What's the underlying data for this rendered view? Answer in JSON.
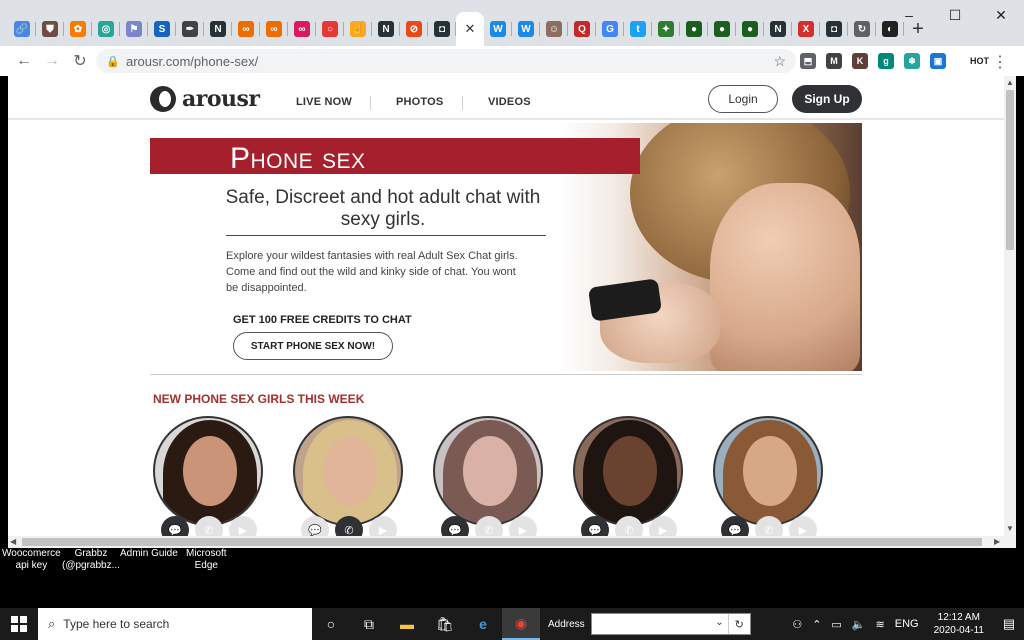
{
  "browser": {
    "tabs": [
      {
        "icon": "link-icon",
        "color": "#4a86e8",
        "glyph": "🔗"
      },
      {
        "icon": "shield-icon",
        "color": "#6d4c41",
        "glyph": "⛊"
      },
      {
        "icon": "orange-flower-icon",
        "color": "#f57c00",
        "glyph": "✿"
      },
      {
        "icon": "teal-swirl-icon",
        "color": "#26a69a",
        "glyph": "◎"
      },
      {
        "icon": "bug-icon",
        "color": "#7986cb",
        "glyph": "⚑"
      },
      {
        "icon": "s-logo-icon",
        "color": "#1565c0",
        "glyph": "S"
      },
      {
        "icon": "feather-icon",
        "color": "#424242",
        "glyph": "✒"
      },
      {
        "icon": "n-doc-icon",
        "color": "#263238",
        "glyph": "N"
      },
      {
        "icon": "orange-chain-icon",
        "color": "#ef6c00",
        "glyph": "∞"
      },
      {
        "icon": "orange-chain-icon",
        "color": "#ef6c00",
        "glyph": "∞"
      },
      {
        "icon": "pink-chain-icon",
        "color": "#d81b60",
        "glyph": "∞"
      },
      {
        "icon": "red-circle-icon",
        "color": "#e53935",
        "glyph": "○"
      },
      {
        "icon": "hand-icon",
        "color": "#f9a825",
        "glyph": "☝"
      },
      {
        "icon": "n-doc-icon",
        "color": "#263238",
        "glyph": "N"
      },
      {
        "icon": "red-compass-icon",
        "color": "#e64a19",
        "glyph": "⊘"
      },
      {
        "icon": "camera-icon",
        "color": "#263238",
        "glyph": "◘"
      },
      {
        "icon": "close-icon",
        "color": "#ffffff",
        "glyph": "✕",
        "active": true
      },
      {
        "icon": "wordpress-icon",
        "color": "#1e88e5",
        "glyph": "W"
      },
      {
        "icon": "wordpress-icon",
        "color": "#1e88e5",
        "glyph": "W"
      },
      {
        "icon": "avatar-icon",
        "color": "#8d6e63",
        "glyph": "☺"
      },
      {
        "icon": "q-icon",
        "color": "#c62828",
        "glyph": "Q"
      },
      {
        "icon": "google-icon",
        "color": "#4285f4",
        "glyph": "G"
      },
      {
        "icon": "twitter-icon",
        "color": "#1da1f2",
        "glyph": "t"
      },
      {
        "icon": "running-icon",
        "color": "#2e7d32",
        "glyph": "✦"
      },
      {
        "icon": "globe-icon",
        "color": "#1b5e20",
        "glyph": "●"
      },
      {
        "icon": "globe-icon",
        "color": "#1b5e20",
        "glyph": "●"
      },
      {
        "icon": "globe-icon",
        "color": "#1b5e20",
        "glyph": "●"
      },
      {
        "icon": "n-doc-icon",
        "color": "#263238",
        "glyph": "N"
      },
      {
        "icon": "red-x-icon",
        "color": "#d32f2f",
        "glyph": "X"
      },
      {
        "icon": "camera-icon",
        "color": "#263238",
        "glyph": "◘"
      },
      {
        "icon": "refresh-globe-icon",
        "color": "#616161",
        "glyph": "↻"
      },
      {
        "icon": "half-circle-icon",
        "color": "#212121",
        "glyph": "◐"
      }
    ],
    "new_tab": "+",
    "url": "arousr.com/phone-sex/",
    "extensions": [
      {
        "icon": "puzzle-icon",
        "color": "#5f6368",
        "glyph": "⬒"
      },
      {
        "icon": "m-icon",
        "color": "#424242",
        "glyph": "M"
      },
      {
        "icon": "k-icon",
        "color": "#5d4037",
        "glyph": "K"
      },
      {
        "icon": "g-icon",
        "color": "#00897b",
        "glyph": "g"
      },
      {
        "icon": "snowflake-icon",
        "color": "#26a69a",
        "glyph": "❄"
      },
      {
        "icon": "card-icon",
        "color": "#1976d2",
        "glyph": "▣"
      }
    ],
    "profile_label": "HOT"
  },
  "site": {
    "logo_text": "arousr",
    "nav": [
      "LIVE NOW",
      "PHOTOS",
      "VIDEOS"
    ],
    "login": "Login",
    "signup": "Sign Up"
  },
  "hero": {
    "title": "Phone sex",
    "subtitle": "Safe, Discreet and hot adult chat with sexy girls.",
    "description": "Explore your wildest fantasies with real Adult Sex Chat girls. Come and find out the wild and kinky side of chat. You wont be disappointed.",
    "credits": "GET 100 FREE CREDITS TO CHAT",
    "cta": "START PHONE SEX NOW!"
  },
  "girls": {
    "heading": "NEW PHONE SEX GIRLS THIS WEEK",
    "cards": [
      {
        "skin": "#c99478",
        "hair": "#2a1a12",
        "bg": "#d8d8d8",
        "chat": true,
        "phone": false,
        "video": false
      },
      {
        "skin": "#e0b59a",
        "hair": "#d9c08a",
        "bg": "#bfa48c",
        "chat": false,
        "phone": true,
        "video": false
      },
      {
        "skin": "#d9b1a6",
        "hair": "#7a5a52",
        "bg": "#c9c1c4",
        "chat": true,
        "phone": false,
        "video": false
      },
      {
        "skin": "#6a4230",
        "hair": "#1e1410",
        "bg": "#8a6a5a",
        "chat": true,
        "phone": false,
        "video": false
      },
      {
        "skin": "#d7a884",
        "hair": "#8a5a36",
        "bg": "#9ab0bf",
        "chat": true,
        "phone": false,
        "video": false
      }
    ]
  },
  "desktop": {
    "icons": [
      {
        "line1": "Woocomerce",
        "line2": "api key"
      },
      {
        "line1": "Grabbz",
        "line2": "(@pgrabbz..."
      },
      {
        "line1": "Admin Guide",
        "line2": ""
      },
      {
        "line1": "Microsoft",
        "line2": "Edge"
      }
    ]
  },
  "taskbar": {
    "search_placeholder": "Type here to search",
    "address_label": "Address",
    "lang": "ENG",
    "time": "12:12 AM",
    "date": "2020-04-11"
  }
}
